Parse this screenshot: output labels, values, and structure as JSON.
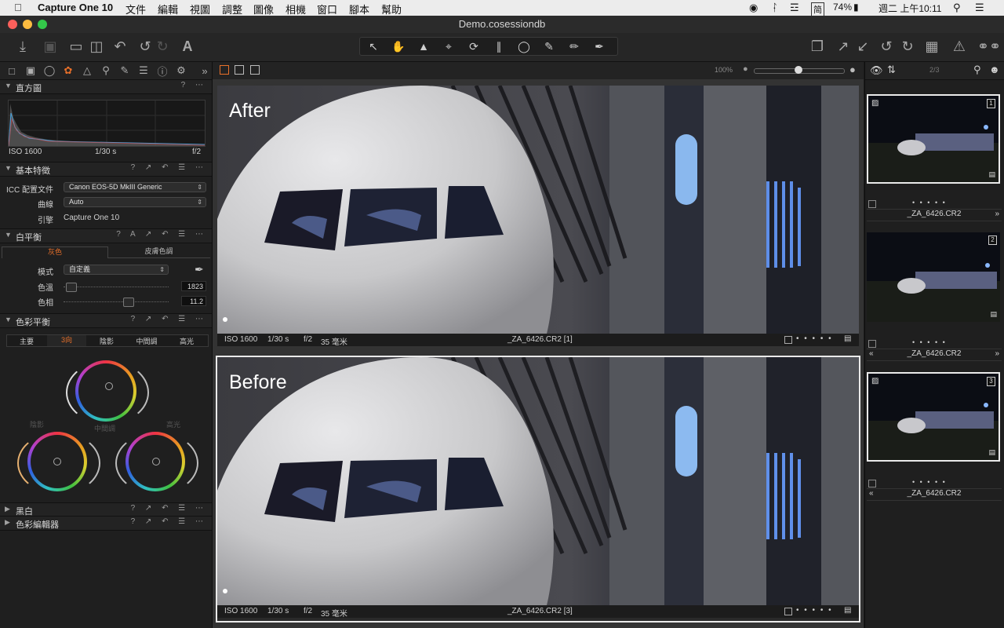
{
  "menubar": {
    "app": "Capture One 10",
    "items": [
      "文件",
      "編輯",
      "視圖",
      "調整",
      "圖像",
      "相機",
      "窗口",
      "腳本",
      "幫助"
    ],
    "battery": "74%",
    "clock": "週二 上午10:11"
  },
  "window": {
    "title": "Demo.cosessiondb"
  },
  "left": {
    "histogram": {
      "title": "直方圖",
      "iso": "ISO 1600",
      "shutter": "1/30 s",
      "aperture": "f/2"
    },
    "basic": {
      "title": "基本特徵",
      "icc_label": "ICC 配置文件",
      "icc_value": "Canon EOS-5D MkIII Generic",
      "curve_label": "曲線",
      "curve_value": "Auto",
      "engine_label": "引擎",
      "engine_value": "Capture One 10"
    },
    "wb": {
      "title": "白平衡",
      "tab_gray": "灰色",
      "tab_skin": "皮膚色調",
      "mode_label": "模式",
      "mode_value": "自定義",
      "temp_label": "色溫",
      "temp_value": "1823",
      "tint_label": "色相",
      "tint_value": "11.2"
    },
    "cb": {
      "title": "色彩平衡",
      "tabs": [
        "主要",
        "3向",
        "陰影",
        "中間調",
        "高光"
      ],
      "shadow": "陰影",
      "mid": "中間調",
      "high": "高光"
    },
    "bw": {
      "title": "黑白"
    },
    "ce": {
      "title": "色彩編輯器"
    }
  },
  "viewer": {
    "zoom": "100%",
    "top": {
      "label": "After",
      "iso": "ISO 1600",
      "shutter": "1/30 s",
      "aperture": "f/2",
      "focal": "35 毫米",
      "file": "_ZA_6426.CR2 [1]"
    },
    "bottom": {
      "label": "Before",
      "iso": "ISO 1600",
      "shutter": "1/30 s",
      "aperture": "f/2",
      "focal": "35 毫米",
      "file": "_ZA_6426.CR2 [3]"
    }
  },
  "browser": {
    "count": "2/3",
    "thumbs": [
      {
        "num": "1",
        "caption": "_ZA_6426.CR2",
        "stars": "• • • • •"
      },
      {
        "num": "2",
        "caption": "_ZA_6426.CR2",
        "stars": "• • • • •"
      },
      {
        "num": "3",
        "caption": "_ZA_6426.CR2",
        "stars": "• • • • •"
      }
    ]
  },
  "colors": {
    "accent": "#e8702a",
    "selected": "#eaeaea"
  }
}
